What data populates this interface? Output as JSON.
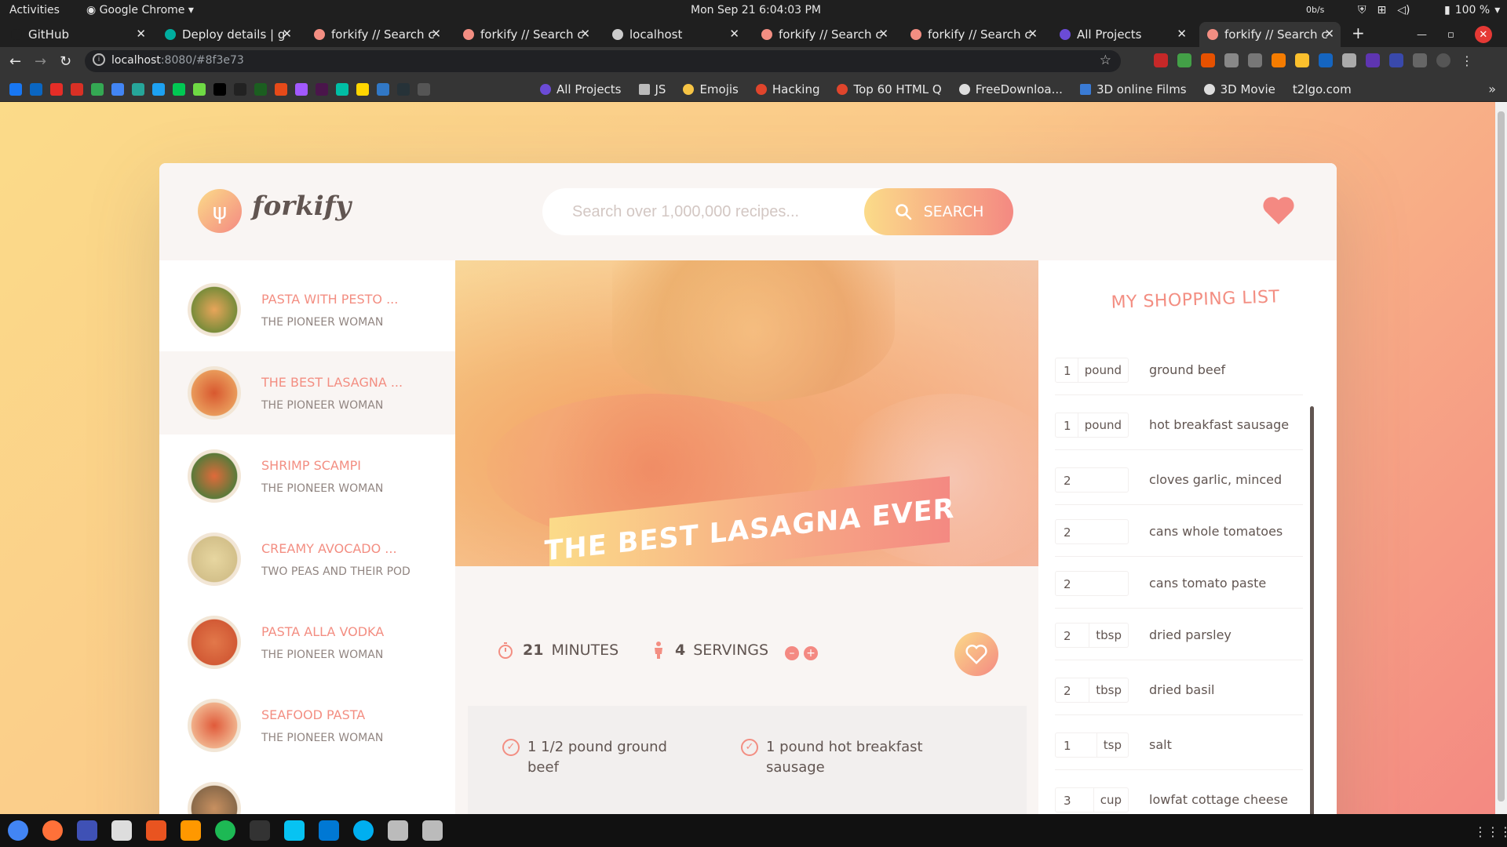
{
  "os": {
    "activities": "Activities",
    "app_menu": "Google Chrome",
    "clock": "Mon Sep 21  6:04:03 PM",
    "net_speed": "0b/s",
    "battery": "100 %"
  },
  "tabs": [
    {
      "label": "GitHub",
      "color": "#1f1f1f"
    },
    {
      "label": "Deploy details | g",
      "color": "#00ad9f"
    },
    {
      "label": "forkify // Search c",
      "color": "#f38e82"
    },
    {
      "label": "forkify // Search c",
      "color": "#f38e82"
    },
    {
      "label": "localhost",
      "color": "#cccccc"
    },
    {
      "label": "forkify // Search c",
      "color": "#f38e82"
    },
    {
      "label": "forkify // Search c",
      "color": "#f38e82"
    },
    {
      "label": "All Projects",
      "color": "#6b4bd6"
    },
    {
      "label": "forkify // Search c",
      "color": "#f38e82"
    }
  ],
  "url": {
    "host": "localhost",
    "rest": ":8080/#8f3e73"
  },
  "bookmarks": [
    {
      "label": "All Projects",
      "color": "#6b4bd6"
    },
    {
      "label": "JS",
      "color": "#bbbbbb"
    },
    {
      "label": "Emojis",
      "color": "#f6c445"
    },
    {
      "label": "Hacking",
      "color": "#e0452c"
    },
    {
      "label": "Top 60 HTML Q",
      "color": "#e0452c"
    },
    {
      "label": "FreeDownloa...",
      "color": "#dddddd"
    },
    {
      "label": "3D online Films",
      "color": "#3a7bd5"
    },
    {
      "label": "3D Movie",
      "color": "#dddddd"
    },
    {
      "label": "t2lgo.com",
      "color": "#353535"
    }
  ],
  "app": {
    "logo_text": "forkify",
    "search_placeholder": "Search over 1,000,000 recipes...",
    "search_button": "SEARCH"
  },
  "results": [
    {
      "title": "PASTA WITH PESTO ...",
      "publisher": "THE PIONEER WOMAN",
      "active": false
    },
    {
      "title": "THE BEST LASAGNA ...",
      "publisher": "THE PIONEER WOMAN",
      "active": true
    },
    {
      "title": "SHRIMP SCAMPI",
      "publisher": "THE PIONEER WOMAN",
      "active": false
    },
    {
      "title": "CREAMY AVOCADO ...",
      "publisher": "TWO PEAS AND THEIR POD",
      "active": false
    },
    {
      "title": "PASTA ALLA VODKA",
      "publisher": "THE PIONEER WOMAN",
      "active": false
    },
    {
      "title": "SEAFOOD PASTA",
      "publisher": "THE PIONEER WOMAN",
      "active": false
    }
  ],
  "recipe": {
    "title": "THE BEST LASAGNA EVER",
    "minutes": "21",
    "minutes_label": "MINUTES",
    "servings": "4",
    "servings_label": "SERVINGS",
    "ingredients": [
      {
        "text": "1 1/2 pound ground beef"
      },
      {
        "text": "1 pound hot breakfast sausage"
      }
    ]
  },
  "shopping": {
    "title": "MY SHOPPING LIST",
    "items": [
      {
        "count": "1",
        "unit": "pound",
        "name": "ground beef"
      },
      {
        "count": "1",
        "unit": "pound",
        "name": "hot breakfast sausage"
      },
      {
        "count": "2",
        "unit": "",
        "name": "cloves garlic, minced"
      },
      {
        "count": "2",
        "unit": "",
        "name": "cans whole tomatoes"
      },
      {
        "count": "2",
        "unit": "",
        "name": "cans tomato paste"
      },
      {
        "count": "2",
        "unit": "tbsp",
        "name": "dried parsley"
      },
      {
        "count": "2",
        "unit": "tbsp",
        "name": "dried basil"
      },
      {
        "count": "1",
        "unit": "tsp",
        "name": "salt"
      },
      {
        "count": "3",
        "unit": "cup",
        "name": "lowfat cottage cheese"
      }
    ]
  }
}
